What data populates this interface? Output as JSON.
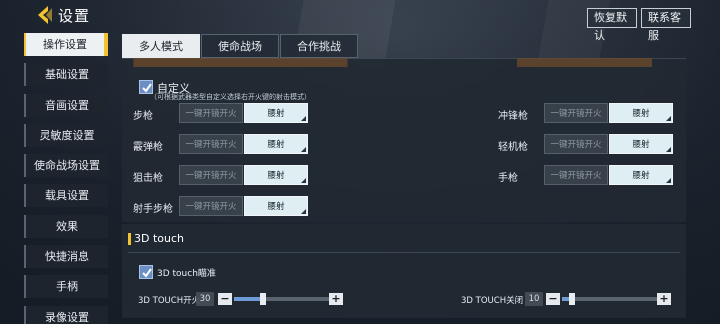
{
  "header": {
    "title": "设置",
    "restore_label": "恢复默认",
    "contact_label": "联系客服"
  },
  "sidebar": {
    "items": [
      {
        "label": "操作设置",
        "active": true
      },
      {
        "label": "基础设置"
      },
      {
        "label": "音画设置"
      },
      {
        "label": "灵敏度设置"
      },
      {
        "label": "使命战场设置"
      },
      {
        "label": "载具设置"
      },
      {
        "label": "效果"
      },
      {
        "label": "快捷消息"
      },
      {
        "label": "手柄"
      },
      {
        "label": "录像设置"
      }
    ]
  },
  "tabs": [
    {
      "label": "多人模式",
      "active": true
    },
    {
      "label": "使命战场"
    },
    {
      "label": "合作挑战"
    }
  ],
  "custom": {
    "label": "自定义",
    "note": "（可根据武器类型自定义选择右开火键的射击模式）",
    "checked": true
  },
  "fire_options": {
    "off_label": "一键开镜开火",
    "on_label": "腰射"
  },
  "weapons_left": [
    {
      "name": "步枪",
      "selected": "腰射"
    },
    {
      "name": "霰弹枪",
      "selected": "腰射"
    },
    {
      "name": "狙击枪",
      "selected": "腰射"
    },
    {
      "name": "射手步枪",
      "selected": "腰射"
    }
  ],
  "weapons_right": [
    {
      "name": "冲锋枪",
      "selected": "腰射"
    },
    {
      "name": "轻机枪",
      "selected": "腰射"
    },
    {
      "name": "手枪",
      "selected": "腰射"
    }
  ],
  "touch3d": {
    "section_title": "3D touch",
    "aim_label": "3D touch瞄准",
    "aim_checked": true,
    "fire": {
      "label": "3D TOUCH开火",
      "value": "30",
      "level": 30
    },
    "close": {
      "label": "3D TOUCH关闭",
      "value": "10",
      "level": 10
    },
    "minus": "−",
    "plus": "+"
  },
  "colors": {
    "accent": "#f2c230",
    "active_option": "#dfeef2",
    "checkbox": "#6b8fc4",
    "slider_fill": "#6e9bd6"
  }
}
